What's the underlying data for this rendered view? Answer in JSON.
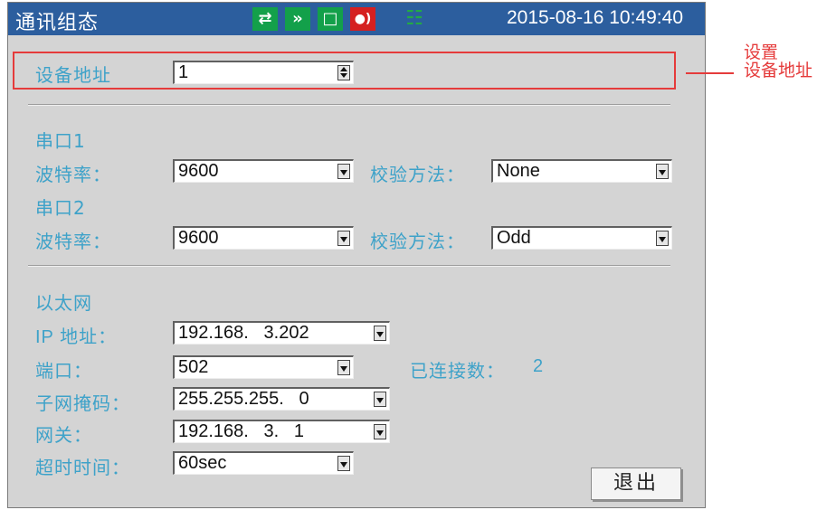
{
  "header": {
    "title": "通讯组态",
    "datetime": "2015-08-16 10:49:40",
    "status_icons": [
      "usb-icon",
      "forward-icon",
      "loop-icon",
      "alarm-icon",
      "network-icon"
    ]
  },
  "device": {
    "label": "设备地址",
    "value": "1"
  },
  "serial1": {
    "heading": "串口1",
    "baud_label": "波特率：",
    "baud_value": "9600",
    "parity_label": "校验方法：",
    "parity_value": "None"
  },
  "serial2": {
    "heading": "串口2",
    "baud_label": "波特率：",
    "baud_value": "9600",
    "parity_label": "校验方法：",
    "parity_value": "Odd"
  },
  "ethernet": {
    "heading": "以太网",
    "ip_label": "IP 地址：",
    "ip_value": "192.168.   3.202",
    "port_label": "端口：",
    "port_value": "502",
    "connections_label": "已连接数：",
    "connections_value": "2",
    "mask_label": "子网掩码：",
    "mask_value": "255.255.255.   0",
    "gateway_label": "网关：",
    "gateway_value": "192.168.   3.   1",
    "timeout_label": "超时时间：",
    "timeout_value": "60sec"
  },
  "exit_label": "退出",
  "annotation": {
    "line1": "设置",
    "line2": "设备地址"
  },
  "colors": {
    "header_bg": "#2c5e9e",
    "panel_bg": "#d4d4d4",
    "label": "#3ea2c9",
    "highlight": "#e53b3b",
    "status_green": "#13a04a",
    "status_red": "#d52020"
  }
}
